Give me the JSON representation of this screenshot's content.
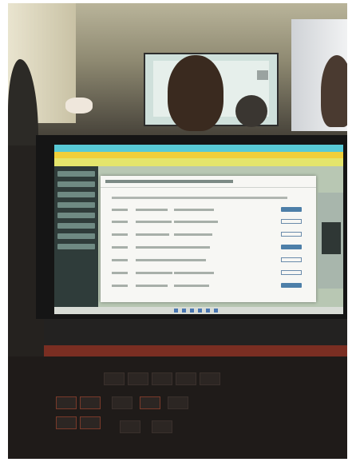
{
  "scene": {
    "type": "photo",
    "description_elements": [
      "presentation-room",
      "projector-screen",
      "audience-heads",
      "laptop-screen",
      "keyboard"
    ]
  },
  "colors": {
    "browser_bar": "#58c9d6",
    "browser_bar_yellow": "#f0cf3a",
    "sidebar": "#2f3c3a",
    "modal_bg": "#f7f7f4",
    "button_blue": "#4d7fa8",
    "keyboard_red": "#7a2e22"
  }
}
